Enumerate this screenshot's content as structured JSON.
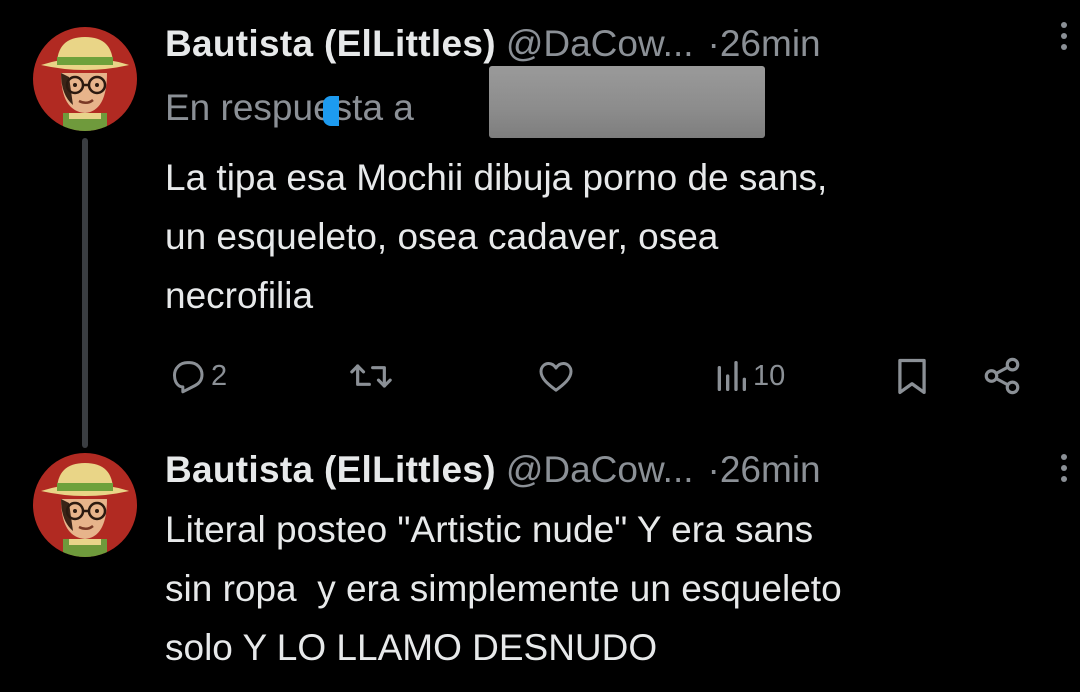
{
  "tweets": [
    {
      "author": {
        "name": "Bautista (ElLittles)",
        "handle": "@DaCow...",
        "avatar_icon": "cartoon-avatar-straw-hat"
      },
      "separator": "·",
      "time": "26min",
      "reply_to": {
        "label": "En respuesta a",
        "redacted": true
      },
      "text_lines": [
        "La tipa esa Mochii dibuja porno de sans,",
        "un esqueleto, osea cadaver, osea",
        "necrofilia"
      ],
      "actions": {
        "reply": {
          "icon": "reply-icon",
          "count": "2"
        },
        "retweet": {
          "icon": "retweet-icon",
          "count": ""
        },
        "like": {
          "icon": "heart-icon",
          "count": ""
        },
        "views": {
          "icon": "views-chart-icon",
          "count": "10"
        },
        "bookmark": {
          "icon": "bookmark-icon"
        },
        "share": {
          "icon": "share-icon"
        }
      }
    },
    {
      "author": {
        "name": "Bautista (ElLittles)",
        "handle": "@DaCow...",
        "avatar_icon": "cartoon-avatar-straw-hat"
      },
      "separator": "·",
      "time": "26min",
      "text_lines": [
        "Literal posteo \"Artistic nude\" Y era sans",
        "sin ropa  y era simplemente un esqueleto",
        "solo Y LO LLAMO DESNUDO"
      ]
    }
  ],
  "colors": {
    "background": "#000000",
    "primary_text": "#e7e9ea",
    "secondary_text": "#8b9096",
    "thread_line": "#3a3d41",
    "accent": "#1d9bf0",
    "avatar_bg": "#b12a22"
  }
}
